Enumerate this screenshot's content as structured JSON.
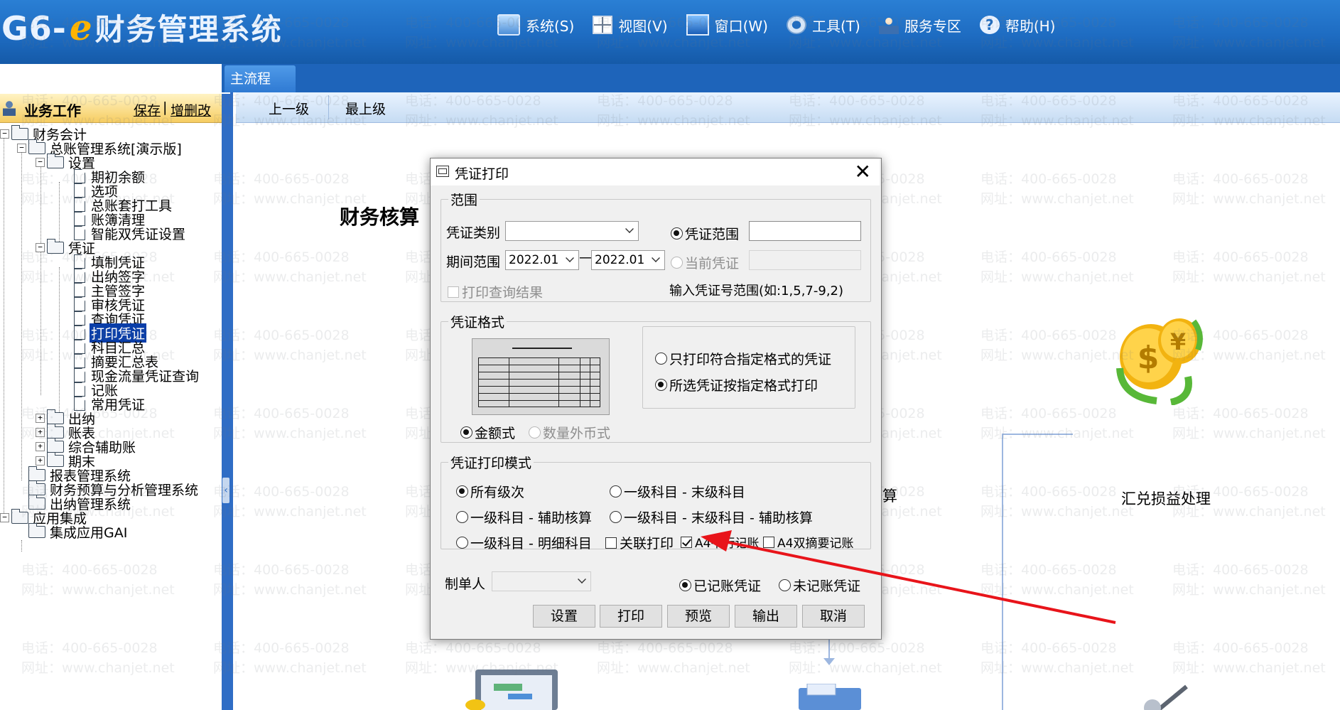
{
  "header": {
    "logo_prefix": "G6-",
    "logo_e": "e",
    "logo_name": "财务管理系统",
    "menu": [
      {
        "label": "系统(S)",
        "icon": "computer-icon"
      },
      {
        "label": "视图(V)",
        "icon": "grid-view-icon"
      },
      {
        "label": "窗口(W)",
        "icon": "window-icon"
      },
      {
        "label": "工具(T)",
        "icon": "gear-icon"
      },
      {
        "label": "服务专区",
        "icon": "user-service-icon"
      },
      {
        "label": "帮助(H)",
        "icon": "help-icon"
      }
    ]
  },
  "tabs": {
    "main": "主流程"
  },
  "left_panel": {
    "title": "业务工作",
    "save": "保存",
    "separator": "|",
    "add_delete": "增删改",
    "tree": {
      "finance": "财务会计",
      "gl_system": "总账管理系统[演示版]",
      "settings": "设置",
      "opening_balance": "期初余额",
      "options": "选项",
      "gl_tool": "总账套打工具",
      "ledger_cleanup": "账簿清理",
      "smart_dual_voucher": "智能双凭证设置",
      "voucher": "凭证",
      "fill_voucher": "填制凭证",
      "cashier_sign": "出纳签字",
      "supervisor_sign": "主管签字",
      "audit_voucher": "审核凭证",
      "query_voucher": "查询凭证",
      "print_voucher": "打印凭证",
      "subject_summary": "科目汇总",
      "abstract_summary": "摘要汇总表",
      "cashflow_query": "现金流量凭证查询",
      "bookkeeping": "记账",
      "common_voucher": "常用凭证",
      "cashier": "出纳",
      "reports": "账表",
      "aux_accounts": "综合辅助账",
      "period_end": "期末",
      "report_mgmt": "报表管理系统",
      "budget_analysis": "财务预算与分析管理系统",
      "cashier_mgmt": "出纳管理系统",
      "app_integration": "应用集成",
      "integration_gai": "集成应用GAI"
    }
  },
  "toolbar": {
    "up": "上一级",
    "top": "最上级"
  },
  "flow": {
    "title": "财务核算",
    "exchange_label": "汇兑损益处理",
    "partial_label": "算"
  },
  "watermark": {
    "phone": "电话：400-665-0028",
    "site": "网址：www.chanjet.net"
  },
  "dialog": {
    "title": "凭证打印",
    "close": "✕",
    "range": {
      "legend": "范围",
      "voucher_type_label": "凭证类别",
      "voucher_type_value": "",
      "period_label": "期间范围",
      "period_from": "2022.01",
      "period_dash": "—",
      "period_to": "2022.01",
      "voucher_range_option": "凭证范围",
      "voucher_range_value": "",
      "current_voucher_option": "当前凭证",
      "print_query_result": "打印查询结果",
      "range_hint": "输入凭证号范围(如:1,5,7-9,2)"
    },
    "format": {
      "legend": "凭证格式",
      "only_matching": "只打印符合指定格式的凭证",
      "by_format": "所选凭证按指定格式打印",
      "amount_style": "金额式",
      "qty_fx_style": "数量外币式"
    },
    "mode": {
      "legend": "凭证打印模式",
      "all_levels": "所有级次",
      "first_to_last": "一级科目 - 末级科目",
      "first_aux": "一级科目 - 辅助核算",
      "first_last_aux": "一级科目 - 末级科目 - 辅助核算",
      "first_detail": "一级科目 - 明细科目",
      "linked_print": "关联打印",
      "a4_parallel": "A4平行记账",
      "a4_dual_abstract": "A4双摘要记账"
    },
    "maker_label": "制单人",
    "maker_value": "",
    "posted": "已记账凭证",
    "unposted": "未记账凭证",
    "buttons": {
      "settings": "设置",
      "print": "打印",
      "preview": "预览",
      "export": "输出",
      "cancel": "取消"
    }
  },
  "colors": {
    "header_blue": "#1e6cc2",
    "panel_header": "#f6cd62",
    "selection": "#0a3ea8",
    "annotation_arrow": "#e8141a"
  }
}
